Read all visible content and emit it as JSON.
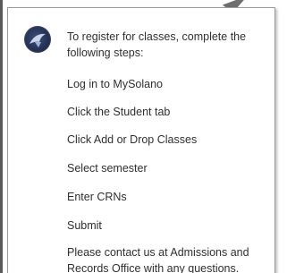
{
  "avatar": {
    "icon": "college-logo-icon",
    "color": "#1f2a4a"
  },
  "message": {
    "intro_line1": "To register for classes, complete the",
    "intro_line2": "following steps:",
    "steps": [
      "Log in to MySolano",
      "Click the Student tab",
      "Click Add or Drop Classes",
      "Select semester",
      "Enter CRNs",
      "Submit"
    ],
    "outro_line1": "Please contact us at Admissions and",
    "outro_line2": "Records Office with any questions."
  }
}
